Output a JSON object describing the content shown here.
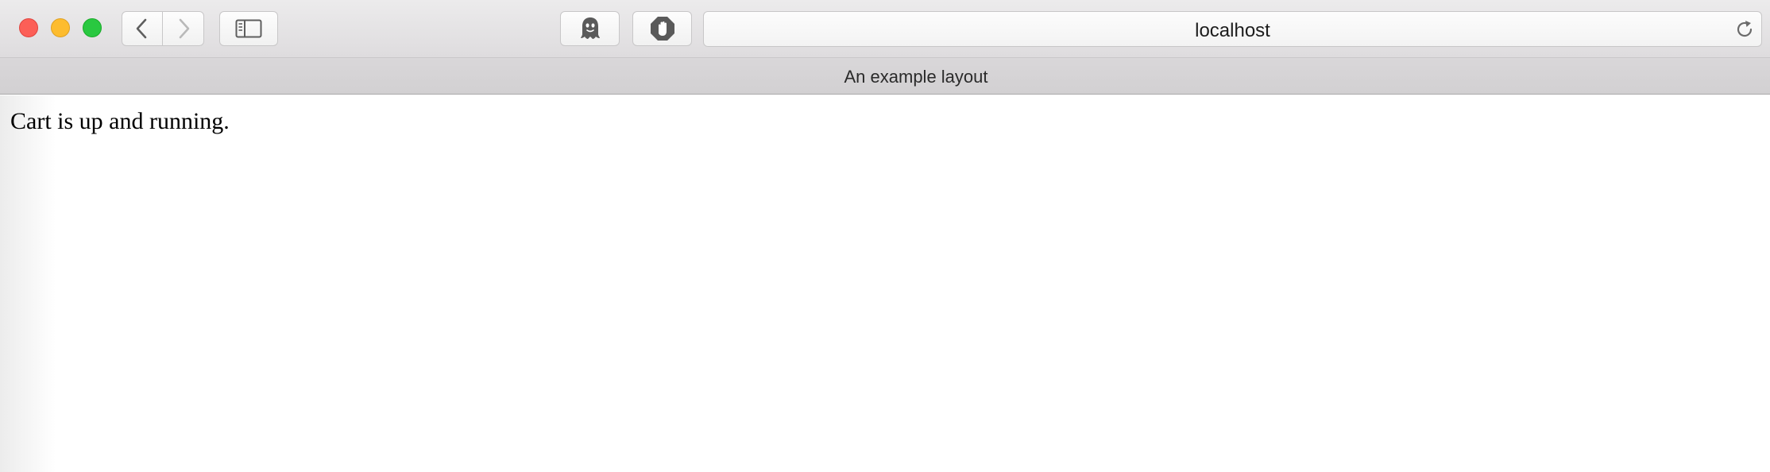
{
  "window": {
    "controls": {
      "close": "close",
      "minimize": "minimize",
      "zoom": "zoom"
    }
  },
  "toolbar": {
    "back_icon": "chevron-left-icon",
    "forward_icon": "chevron-right-icon",
    "sidebar_icon": "sidebar-icon",
    "extension_1_icon": "ghost-icon",
    "extension_2_icon": "stop-hand-icon",
    "address": "localhost",
    "reload_icon": "reload-icon"
  },
  "tab": {
    "title": "An example layout"
  },
  "page": {
    "body_text": "Cart is up and running."
  },
  "colors": {
    "close": "#fc5f57",
    "minimize": "#fdbc2e",
    "zoom": "#29c840"
  }
}
